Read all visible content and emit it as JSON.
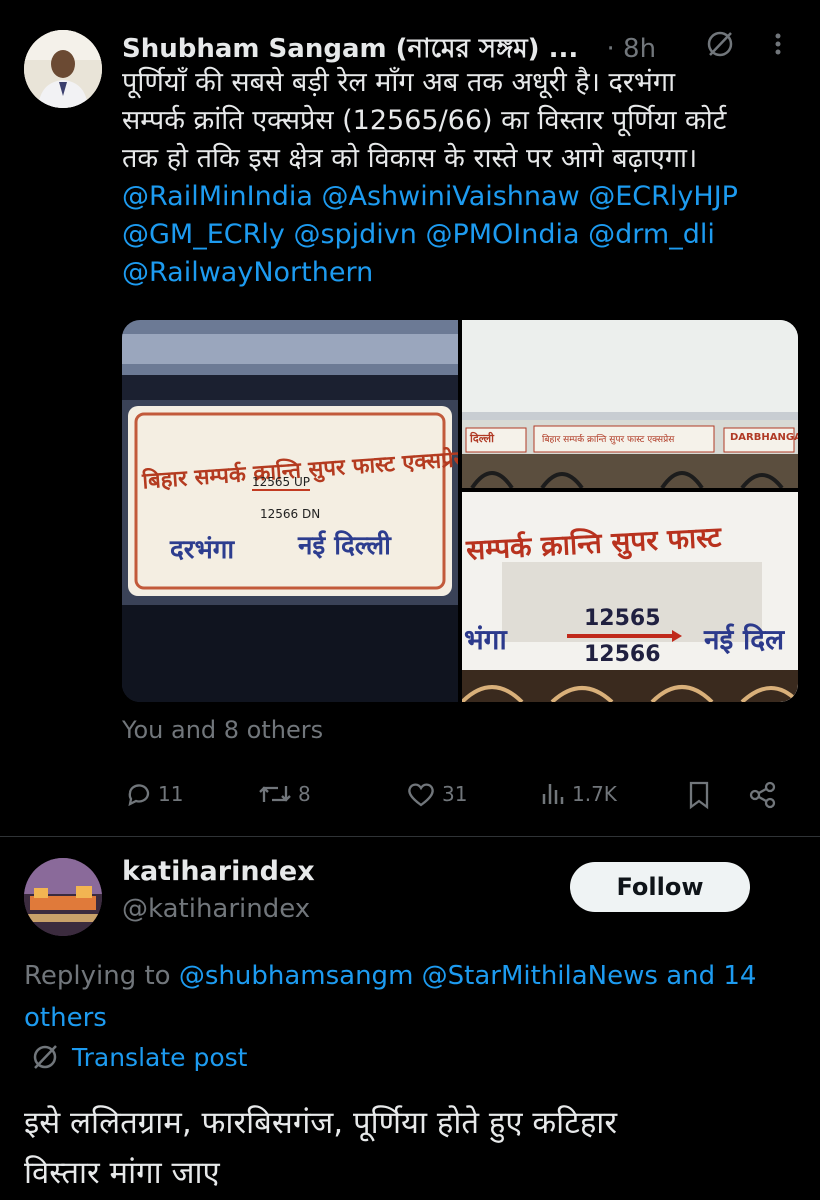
{
  "post": {
    "author_name": "Shubham Sangam (নামের সঙ্গম) ...",
    "time": "· 8h",
    "text_lines": [
      "पूर्णियाँ की सबसे बड़ी रेल माँग अब तक अधूरी है। दरभंगा",
      "सम्पर्क क्रांति एक्सप्रेस (12565/66) का विस्तार पूर्णिया कोर्ट",
      "तक हो तकि इस क्षेत्र को विकास के रास्ते पर आगे बढ़ाएगा।"
    ],
    "mentions_line1": "@RailMinIndia @AshwiniVaishnaw @ECRlyHJP",
    "mentions_line2": "@GM_ECRly @spjdivn @PMOIndia @drm_dli",
    "mentions_line3": "@RailwayNorthern",
    "image_left": {
      "sign_text": "बिहार सम्पर्क क्रान्ति सुपर फास्ट एक्सप्रेस",
      "up": "12565 UP",
      "dn": "12566 DN",
      "from": "दरभंगा",
      "to": "नई दिल्ली"
    },
    "image_right_top": {
      "left_board": "दिल्ली",
      "middle_board": "बिहार सम्पर्क क्रान्ति सुपर फास्ट एक्सप्रेस",
      "right_board": "DARBHANGA"
    },
    "image_right_bottom": {
      "sign_text": "सम्पर्क क्रान्ति सुपर फास्ट",
      "num_up": "12565",
      "num_dn": "12566",
      "from": "भंगा",
      "to": "नई दिल"
    },
    "liked_by": "You and 8 others",
    "actions": {
      "replies": "11",
      "reposts": "8",
      "likes": "31",
      "views": "1.7K"
    }
  },
  "reply": {
    "author_name": "katiharindex",
    "handle": "@katiharindex",
    "follow_label": "Follow",
    "replying_prefix": "Replying to",
    "replying_mentions": "@shubhamsangm @StarMithilaNews and 14",
    "replying_suffix": "others",
    "translate_label": "Translate post",
    "text_line1": "इसे ललितग्राम, फारबिसगंज, पूर्णिया होते हुए कटिहार",
    "text_line2": "विस्तार मांगा जाए"
  },
  "colors": {
    "background": "#000000",
    "text": "#e7e9ea",
    "muted": "#71767b",
    "link": "#1d9bf0"
  }
}
